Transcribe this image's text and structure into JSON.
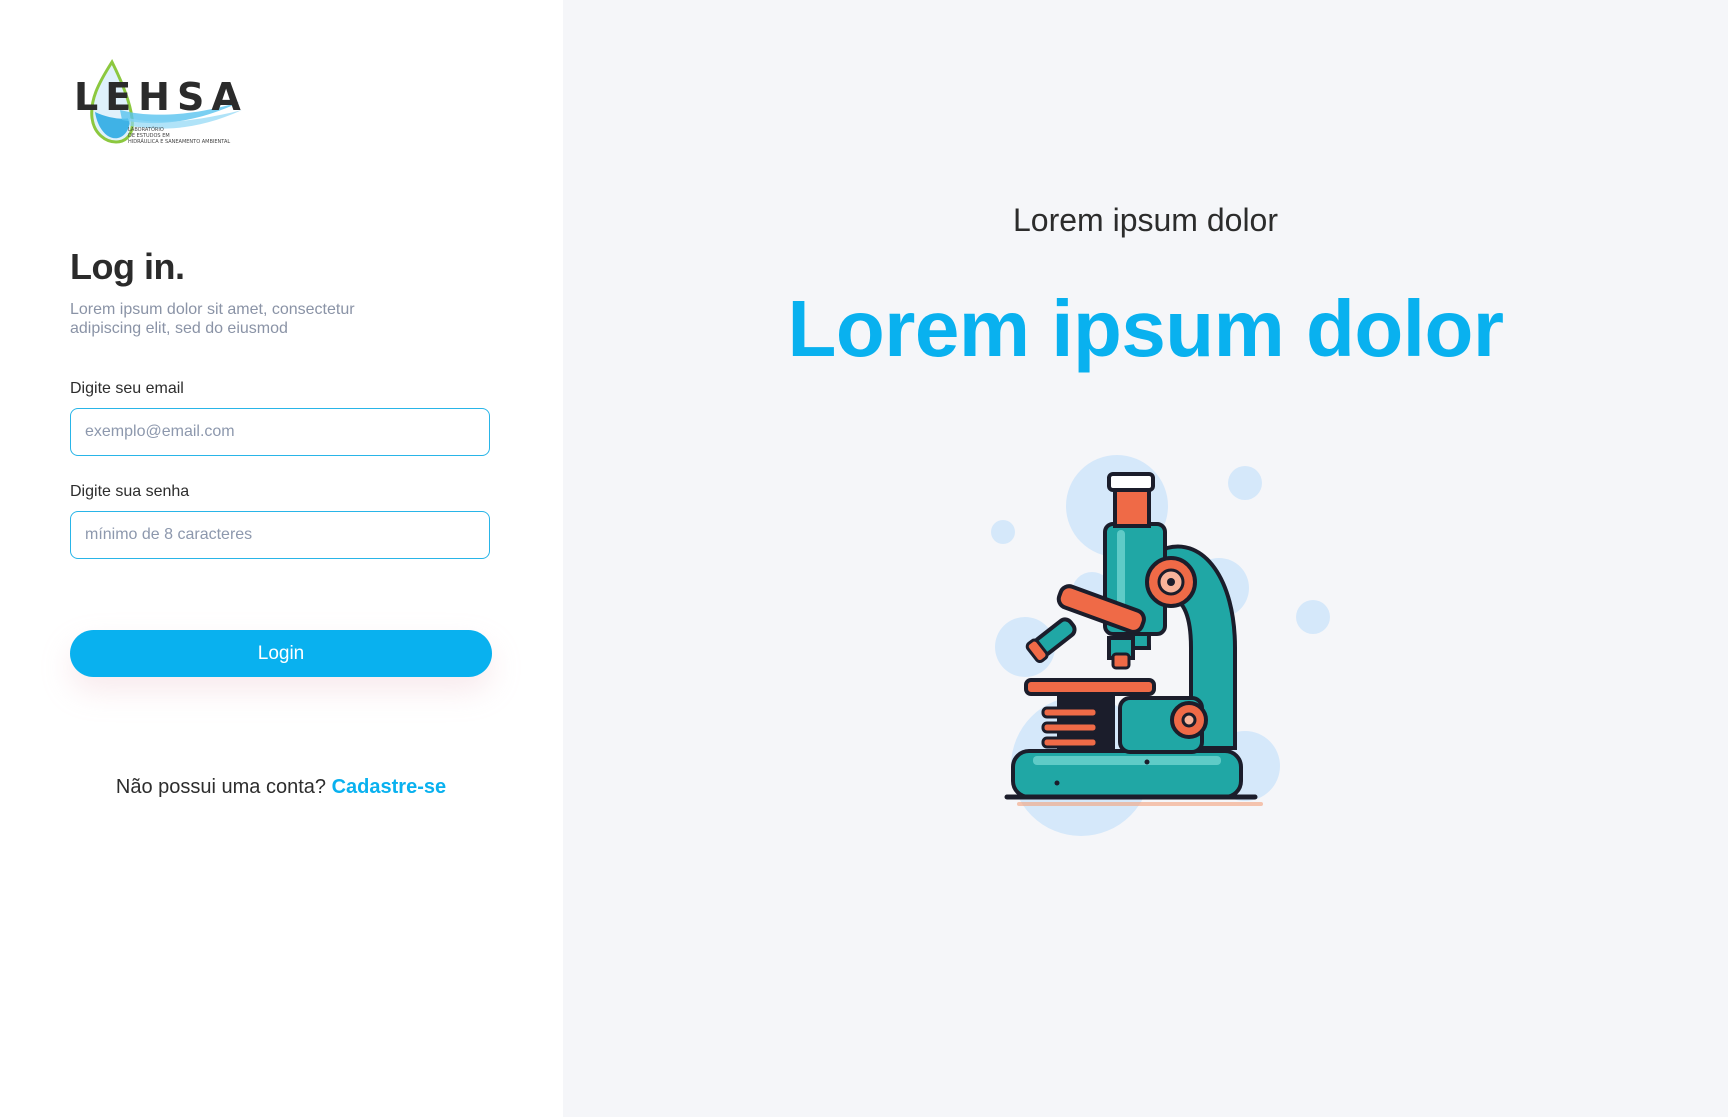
{
  "logo": {
    "wordmark": "LEHSA",
    "tagline": "LABORATÓRIO DE ESTUDOS EM HIDRÁULICA E SANEAMENTO AMBIENTAL"
  },
  "login": {
    "title": "Log in.",
    "subtitle": "Lorem ipsum dolor sit amet, consectetur adipiscing elit, sed do eiusmod",
    "email_label": "Digite seu email",
    "email_placeholder": "exemplo@email.com",
    "password_label": "Digite sua senha",
    "password_placeholder": "mínimo de 8 caracteres",
    "button_label": "Login",
    "signup_prompt": "Não possui uma conta?",
    "signup_link": "Cadastre-se"
  },
  "hero": {
    "small_text": "Lorem ipsum dolor",
    "big_text": "Lorem ipsum dolor",
    "illustration_icon": "microscope-icon"
  },
  "colors": {
    "accent": "#09b1ef",
    "right_panel_bg": "#f5f6f9",
    "input_border": "#29b5e8"
  }
}
